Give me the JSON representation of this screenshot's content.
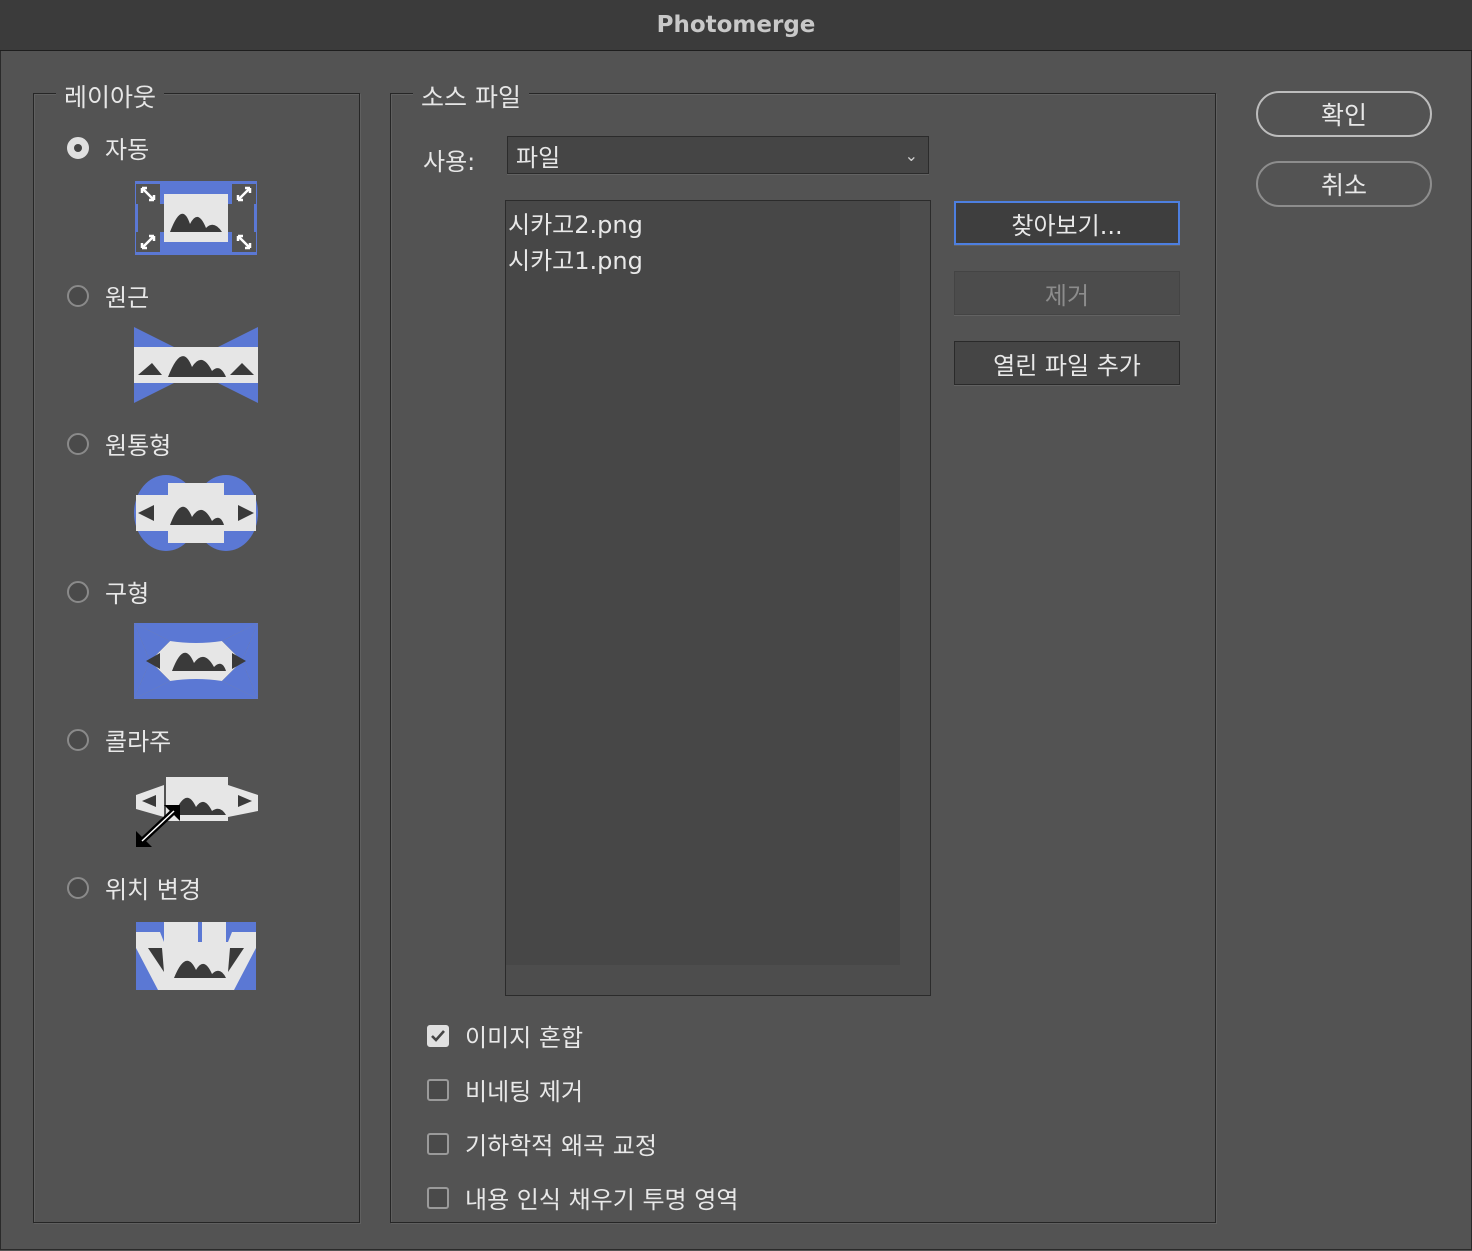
{
  "window": {
    "title": "Photomerge"
  },
  "layout": {
    "title": "레이아웃",
    "options": [
      {
        "label": "자동",
        "checked": true,
        "icon": "auto-layout-icon"
      },
      {
        "label": "원근",
        "checked": false,
        "icon": "perspective-layout-icon"
      },
      {
        "label": "원통형",
        "checked": false,
        "icon": "cylindrical-layout-icon"
      },
      {
        "label": "구형",
        "checked": false,
        "icon": "spherical-layout-icon"
      },
      {
        "label": "콜라주",
        "checked": false,
        "icon": "collage-layout-icon"
      },
      {
        "label": "위치 변경",
        "checked": false,
        "icon": "reposition-layout-icon"
      }
    ]
  },
  "source": {
    "title": "소스 파일",
    "use_label": "사용:",
    "use_value": "파일",
    "files": [
      "시카고2.png",
      "시카고1.png"
    ],
    "browse_label": "찾아보기...",
    "remove_label": "제거",
    "add_open_label": "열린 파일 추가"
  },
  "options": [
    {
      "label": "이미지 혼합",
      "checked": true
    },
    {
      "label": "비네팅 제거",
      "checked": false
    },
    {
      "label": "기하학적 왜곡 교정",
      "checked": false
    },
    {
      "label": "내용 인식 채우기 투명 영역",
      "checked": false
    }
  ],
  "actions": {
    "ok_label": "확인",
    "cancel_label": "취소"
  },
  "colors": {
    "accent": "#4d7fe0",
    "thumb_blue": "#5b78d4",
    "thumb_light": "#e6e6e6",
    "thumb_dark": "#3a3a3a"
  }
}
